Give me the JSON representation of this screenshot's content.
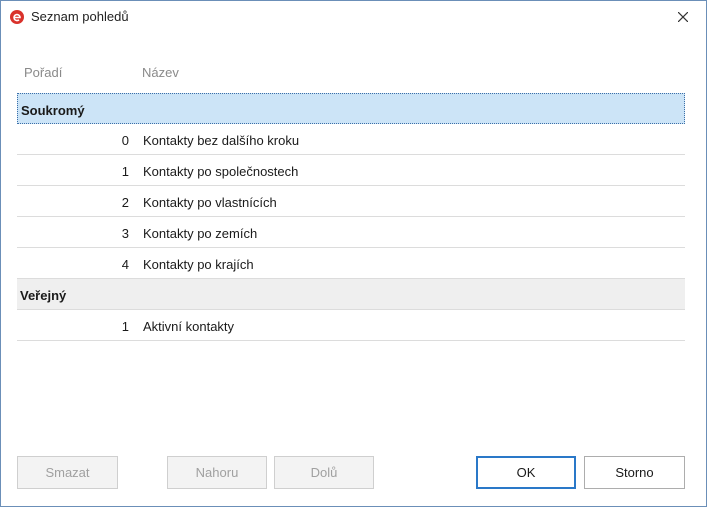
{
  "window": {
    "title": "Seznam pohledů",
    "icon": "app-logo-icon",
    "close_icon": "close-icon"
  },
  "columns": {
    "order": "Pořadí",
    "name": "Název"
  },
  "groups": [
    {
      "label": "Soukromý",
      "selected": true,
      "items": [
        {
          "order": "0",
          "name": "Kontakty bez dalšího kroku"
        },
        {
          "order": "1",
          "name": "Kontakty po společnostech"
        },
        {
          "order": "2",
          "name": "Kontakty po vlastnících"
        },
        {
          "order": "3",
          "name": "Kontakty po zemích"
        },
        {
          "order": "4",
          "name": "Kontakty po krajích"
        }
      ]
    },
    {
      "label": "Veřejný",
      "selected": false,
      "items": [
        {
          "order": "1",
          "name": "Aktivní kontakty"
        }
      ]
    }
  ],
  "buttons": {
    "delete": "Smazat",
    "up": "Nahoru",
    "down": "Dolů",
    "ok": "OK",
    "cancel": "Storno"
  },
  "colors": {
    "selection": "#cce4f7",
    "group_bg": "#efefef",
    "accent": "#2a78c8",
    "icon_red": "#d9322b"
  }
}
